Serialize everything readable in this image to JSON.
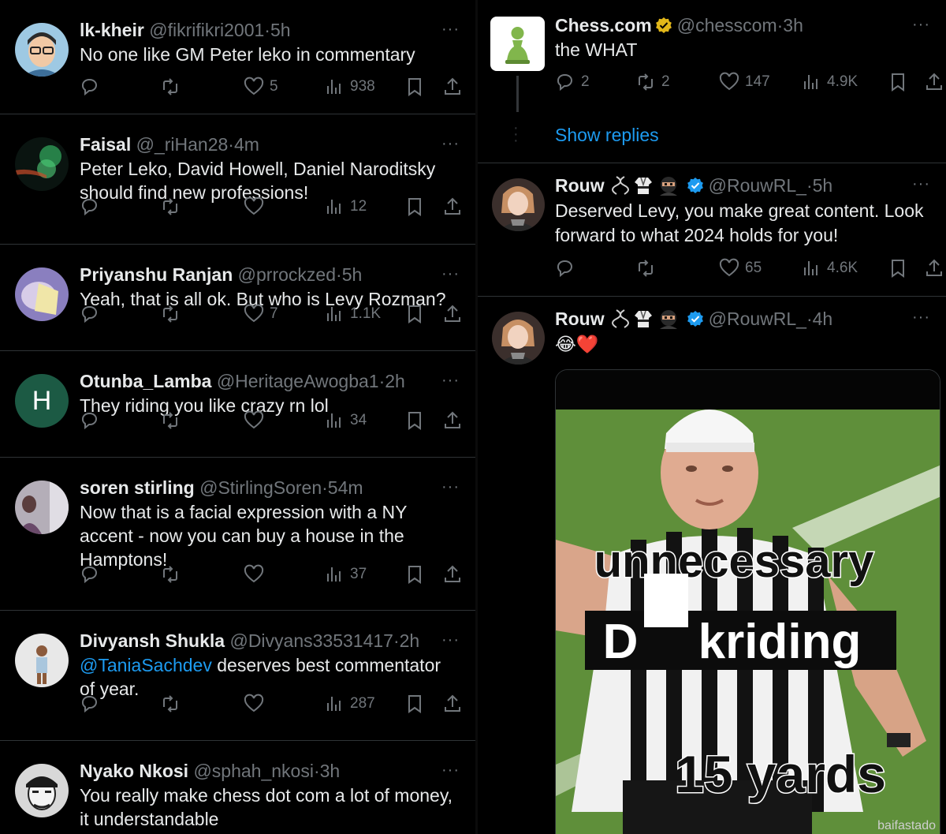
{
  "left_feed": [
    {
      "name": "lk-kheir",
      "handle": "@fikrifikri2001",
      "time": "5h",
      "text": "No one like GM Peter leko in commentary",
      "likes": "5",
      "views": "938"
    },
    {
      "name": "Faisal",
      "handle": "@_riHan28",
      "time": "4m",
      "text": "Peter Leko, David Howell, Daniel Naroditsky should find new professions!",
      "likes": "",
      "views": "12"
    },
    {
      "name": "Priyanshu Ranjan",
      "handle": "@prrockzed",
      "time": "5h",
      "text": "Yeah, that is all ok. But who is Levy Rozman?",
      "likes": "7",
      "views": "1.1K"
    },
    {
      "name": "Otunba_Lamba",
      "handle": "@HeritageAwogba1",
      "time": "2h",
      "text": "They riding you like crazy rn lol",
      "likes": "",
      "views": "34",
      "avatar_letter": "H"
    },
    {
      "name": "soren stirling",
      "handle": "@StirlingSoren",
      "time": "54m",
      "text": "Now that is a facial expression with a NY accent - now you can buy a house in the Hamptons!",
      "likes": "",
      "views": "37"
    },
    {
      "name": "Divyansh Shukla",
      "handle": "@Divyans33531417",
      "time": "2h",
      "mention": "@TaniaSachdev",
      "text": " deserves best commentator of year.",
      "likes": "",
      "views": "287"
    },
    {
      "name": "Nyako Nkosi",
      "handle": "@sphah_nkosi",
      "time": "3h",
      "text": "You really make chess dot com a lot of money, it understandable"
    }
  ],
  "right_feed": {
    "chesscom": {
      "name": "Chess.com",
      "handle": "@chesscom",
      "time": "3h",
      "text": "the WHAT",
      "replies": "2",
      "retweets": "2",
      "likes": "147",
      "views": "4.9K"
    },
    "show_replies": "Show replies",
    "rouw1": {
      "name": "Rouw",
      "handle": "@RouwRL_",
      "time": "5h",
      "text": "Deserved Levy, you make great content. Look forward to what 2024 holds for you!",
      "likes": "65",
      "views": "4.6K"
    },
    "rouw2": {
      "name": "Rouw",
      "handle": "@RouwRL_",
      "time": "4h",
      "text": "😂❤️"
    },
    "meme": {
      "line1": "unnecessary",
      "line2_a": "D",
      "line2_b": "kriding",
      "line3": "15 yards",
      "watermark": "baifastado"
    }
  },
  "separator": "·",
  "more_icon": "···",
  "colors": {
    "background": "#000000",
    "text": "#e7e9ea",
    "muted": "#71767b",
    "accent": "#1d9bf0",
    "border": "#2f3336",
    "chess_green": "#81b64c"
  }
}
